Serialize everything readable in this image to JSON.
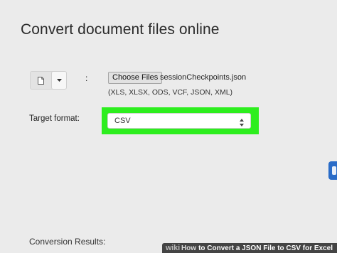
{
  "page": {
    "title": "Convert document files online"
  },
  "upload": {
    "colon": ":",
    "choose_button": "Choose Files",
    "file_name": "sessionCheckpoints.json",
    "formats_hint": "(XLS, XLSX, ODS, VCF, JSON, XML)",
    "source_icon": "document-icon",
    "dropdown_icon": "caret-down-icon"
  },
  "target": {
    "label": "Target format:",
    "selected": "CSV",
    "highlight_color": "#2dee1e",
    "select_icon": "up-down-arrows-icon"
  },
  "results": {
    "label": "Conversion Results:"
  },
  "watermark": {
    "brand": "wiki",
    "how": "How",
    "text": "to Convert a JSON File to CSV for Excel"
  },
  "colors": {
    "side_button": "#2a6cc8",
    "background": "#ebebeb"
  }
}
